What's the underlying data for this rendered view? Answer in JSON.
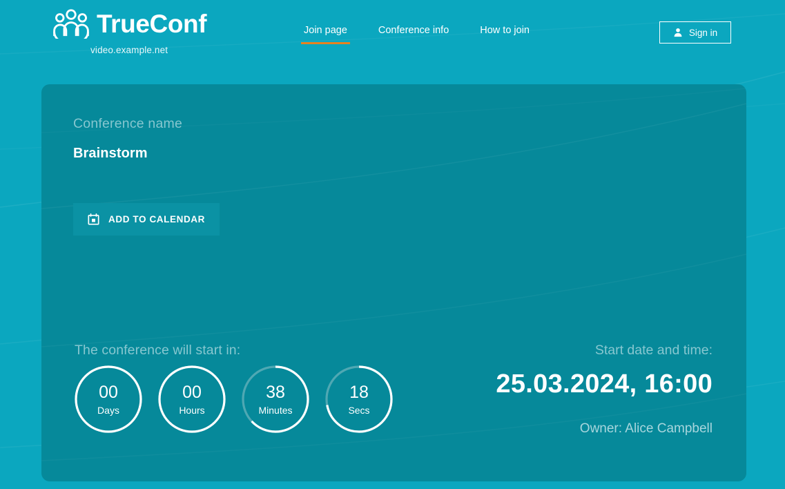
{
  "header": {
    "logo_text": "TrueConf",
    "logo_icon": "group-people-icon",
    "domain": "video.example.net",
    "nav": [
      {
        "label": "Join page",
        "active": true
      },
      {
        "label": "Conference info",
        "active": false
      },
      {
        "label": "How to join",
        "active": false
      }
    ],
    "signin": {
      "label": "Sign in",
      "icon": "person-icon"
    }
  },
  "card": {
    "conference_name_label": "Conference name",
    "conference_name": "Brainstorm",
    "add_to_calendar": {
      "label": "ADD TO CALENDAR",
      "icon": "calendar-icon"
    },
    "countdown": {
      "label": "The conference will start in:",
      "units": [
        {
          "value": "00",
          "unit": "Days",
          "progress": 100
        },
        {
          "value": "00",
          "unit": "Hours",
          "progress": 100
        },
        {
          "value": "38",
          "unit": "Minutes",
          "progress": 63
        },
        {
          "value": "18",
          "unit": "Secs",
          "progress": 72
        }
      ]
    },
    "start": {
      "label": "Start date and time:",
      "value": "25.03.2024, 16:00"
    },
    "owner": "Owner: Alice Campbell"
  },
  "colors": {
    "page_background": "#0ba7bf",
    "card_background": "#06899a",
    "accent_orange": "#e8821e",
    "muted_text": "#87c7d0",
    "white": "#ffffff",
    "button_background": "#0b92a4",
    "ring_track": "#4fa8b3"
  }
}
